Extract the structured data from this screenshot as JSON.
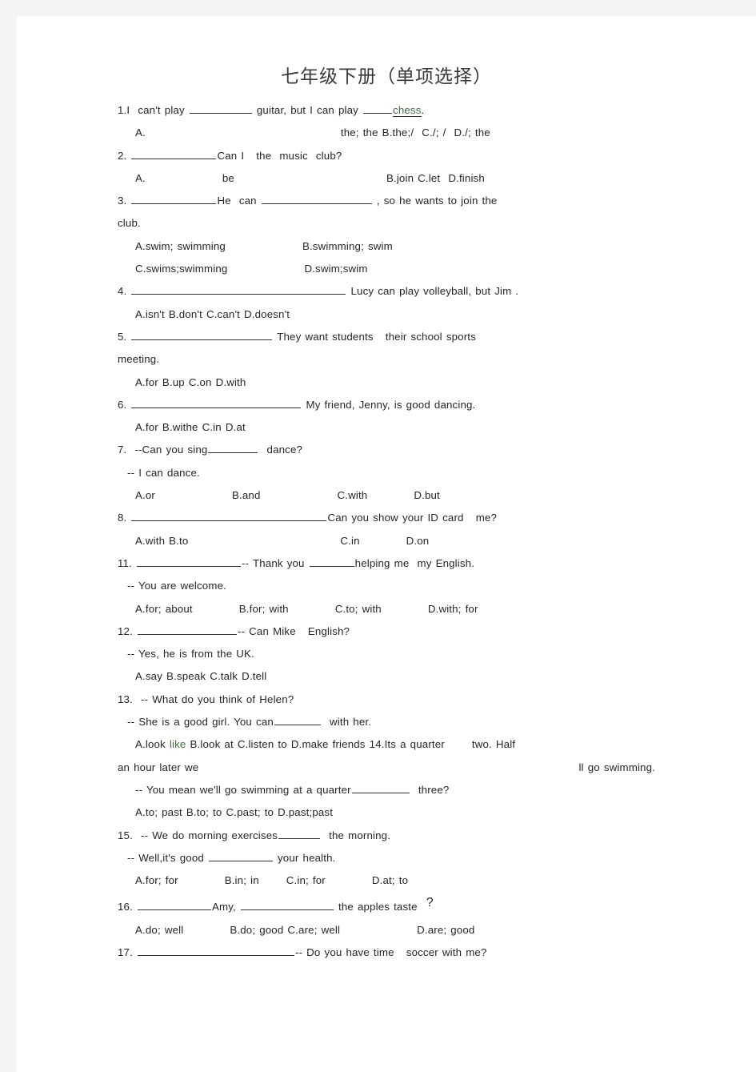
{
  "document": {
    "title": "七年级下册（单项选择）",
    "accent_green": "#3f6b45",
    "text_color": "#262626",
    "page_background": "#ffffff",
    "canvas_background": "#f4f4f4"
  },
  "questions": {
    "q1_stem_a": "1.I  can't play ",
    "q1_stem_b": " guitar, but I can play ",
    "q1_stem_c": "chess",
    "q1_stem_d": ".",
    "q1_options_a": "A.",
    "q1_options_b": "the; the B.the;/  C./; /  D./; the",
    "q2_stem_a": "2. ",
    "q2_stem_b": "Can I   the  music  club?",
    "q2_options_a": "A.",
    "q2_options_b": "be",
    "q2_options_c": "B.join C.let  D.finish",
    "q3_stem_a": "3. ",
    "q3_stem_b": "He  can ",
    "q3_stem_c": " , so he wants to join the",
    "q3_stem_cont": "club.",
    "q3_options_1a": "A.swim; swimming",
    "q3_options_1b": "B.swimming; swim",
    "q3_options_2a": "C.swims;swimming",
    "q3_options_2b": "D.swim;swim",
    "q4_stem_a": "4. ",
    "q4_stem_b": " Lucy can play volleyball, but Jim .",
    "q4_options": "A.isn't B.don't C.can't D.doesn't",
    "q5_stem_a": "5. ",
    "q5_stem_b": " They want students   their school sports",
    "q5_stem_cont": "meeting.",
    "q5_options": "A.for B.up C.on D.with",
    "q6_stem_a": "6. ",
    "q6_stem_b": " My friend, Jenny, is good dancing.",
    "q6_options": "A.for B.withe C.in D.at",
    "q7_stem_a": "7.  --Can you sing",
    "q7_stem_b": "  dance?",
    "q7_reply": "-- I can dance.",
    "q7_options_a": "A.or",
    "q7_options_b": "B.and",
    "q7_options_c": "C.with",
    "q7_options_d": "D.but",
    "q8_stem_a": "8. ",
    "q8_stem_b": "Can you show your ID card   me?",
    "q8_options_a": "A.with B.to",
    "q8_options_b": "C.in",
    "q8_options_c": "D.on",
    "q11_stem_a": "11. ",
    "q11_stem_b": "-- Thank you ",
    "q11_stem_c": "helping me  my English.",
    "q11_reply": "-- You are welcome.",
    "q11_options_a": "A.for; about",
    "q11_options_b": "B.for; with",
    "q11_options_c": "C.to; with",
    "q11_options_d": "D.with; for",
    "q12_stem_a": "12. ",
    "q12_stem_b": "-- Can Mike   English?",
    "q12_reply": "-- Yes, he is from the UK.",
    "q12_options": "A.say B.speak C.talk D.tell",
    "q13_stem": "13.  -- What do you think of Helen?",
    "q13_reply_a": "-- She is a good girl. You ",
    "q13_reply_b": "can",
    "q13_reply_c": "  with her.",
    "q13_options_a": "A.look ",
    "q13_options_b": "like",
    "q13_options_c": " B.look at C.listen to D.make friends 14.",
    "q13_options_d": "Its a quarter",
    "q13_options_e": "two. Half",
    "q14_cont_left": "an hour later we",
    "q14_cont_right": "ll go swimming.",
    "q14_reply_a": "-- You mean we'll go swimming at a quarter",
    "q14_reply_b": "  three?",
    "q14_options": "A.to; past B.to; to C.past; to D.past;past",
    "q15_stem_a": "15.  -- We do morning exercises",
    "q15_stem_b": "  the morning.",
    "q15_reply_a": "-- Well,it's good ",
    "q15_reply_b": " your health.",
    "q15_options_a": "A.for; for",
    "q15_options_b": "B.in; in",
    "q15_options_c": "C.in; for",
    "q15_options_d": "D.at; to",
    "q16_stem_a": "16. ",
    "q16_stem_b": "Amy, ",
    "q16_stem_c": " the apples taste ",
    "q16_stem_qmark": "?",
    "q16_options_a": "A.do; well",
    "q16_options_b": "B.do; good C.are; well",
    "q16_options_c": "D.are; good",
    "q17_stem_a": "17. ",
    "q17_stem_b": "-- Do you have time   soccer with me?"
  }
}
